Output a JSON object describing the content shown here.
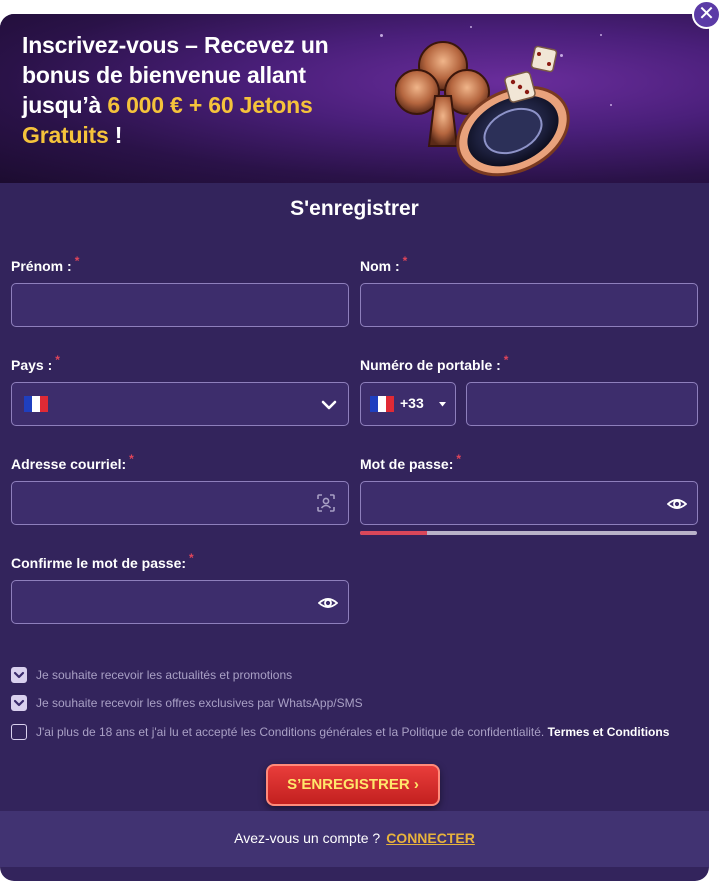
{
  "banner": {
    "line1": "Inscrivez-vous – Recevez un",
    "line2": "bonus de bienvenue allant",
    "line3_prefix": "jusqu’à ",
    "line3_highlight": "6 000 € + 60 Jetons",
    "line4_highlight": "Gratuits",
    "line4_suffix": " !"
  },
  "close_button": "✕",
  "form": {
    "title": "S'enregistrer",
    "required_mark": "*",
    "first_name_label": "Prénom :",
    "last_name_label": "Nom :",
    "country_label": "Pays :",
    "phone_label": "Numéro de portable :",
    "phone_prefix": "+33",
    "email_label": "Adresse courriel:",
    "password_label": "Mot de passe:",
    "password_strength": 0.2,
    "confirm_label": "Confirme le mot de passe:",
    "first_name_value": "",
    "last_name_value": "",
    "phone_value": "",
    "email_value": "",
    "password_value": "",
    "confirm_value": "",
    "country_flag": "fr-flag"
  },
  "checkboxes": [
    {
      "text": "Je souhaite recevoir les actualités et promotions",
      "checked": true
    },
    {
      "text": "Je souhaite recevoir les offres exclusives par WhatsApp/SMS",
      "checked": true
    },
    {
      "text": "J'ai plus de 18 ans et j'ai lu et accepté les Conditions générales et la Politique de confidentialité.",
      "link": "Termes et Conditions",
      "checked": false
    }
  ],
  "submit_label": "S’ENREGISTRER ›",
  "footer": {
    "question": "Avez-vous un compte ?",
    "login_link": "CONNECTER"
  },
  "colors": {
    "accent_gold": "#f5c33b",
    "required_red": "#e0455a",
    "submit_red": "#d42c2b",
    "panel": "#33245c"
  }
}
